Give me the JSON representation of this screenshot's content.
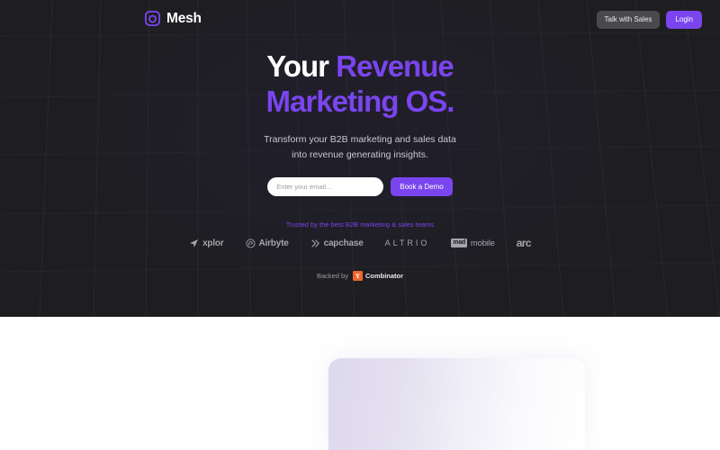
{
  "brand": {
    "name": "Mesh",
    "logo_icon": "mesh-rounded-square-circle-icon",
    "accent_color": "#7a45ef"
  },
  "nav": {
    "talk_with_sales_label": "Talk with Sales",
    "login_label": "Login"
  },
  "hero": {
    "headline_line1_white": "Your ",
    "headline_line1_accent": "Revenue",
    "headline_line2_accent": "Marketing OS.",
    "subhead_line1": "Transform your B2B marketing and sales data",
    "subhead_line2": "into revenue generating insights.",
    "email_placeholder": "Enter your email...",
    "email_value": "",
    "book_demo_label": "Book a Demo",
    "trust_line": "Trusted by the best B2B marketing & sales teams",
    "background_color": "#1e1e20"
  },
  "logos": [
    {
      "name": "xplor",
      "icon": "paper-plane-icon"
    },
    {
      "name": "Airbyte",
      "icon": "airbyte-spiral-icon"
    },
    {
      "name": "capchase",
      "icon": "capchase-chevrons-icon"
    },
    {
      "name": "ALTRIO",
      "icon": ""
    },
    {
      "name": "mobile",
      "icon": "mad-box-icon",
      "prefix": "mad"
    },
    {
      "name": "arc",
      "icon": ""
    }
  ],
  "backed_by": {
    "label": "Backed by",
    "badge_letter": "Y",
    "badge_text": "Combinator",
    "badge_color": "#f0652b"
  },
  "lower_section": {
    "background_color": "#ffffff",
    "card_gradient_from": "#ddd8ec",
    "card_gradient_to": "#ffffff"
  }
}
